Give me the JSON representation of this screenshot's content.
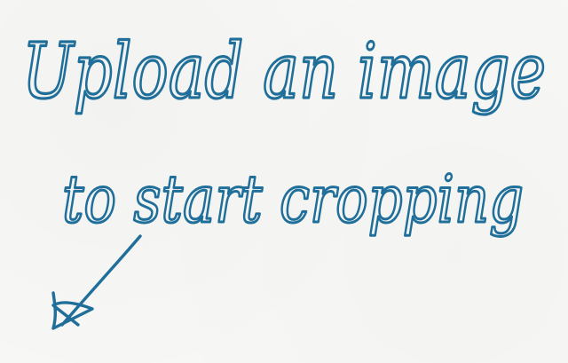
{
  "upload_hint": {
    "line1": "Upload an image",
    "line2": "to start cropping"
  },
  "ink_color": "#1f6f9a",
  "paper_color": "#f7f7f5"
}
